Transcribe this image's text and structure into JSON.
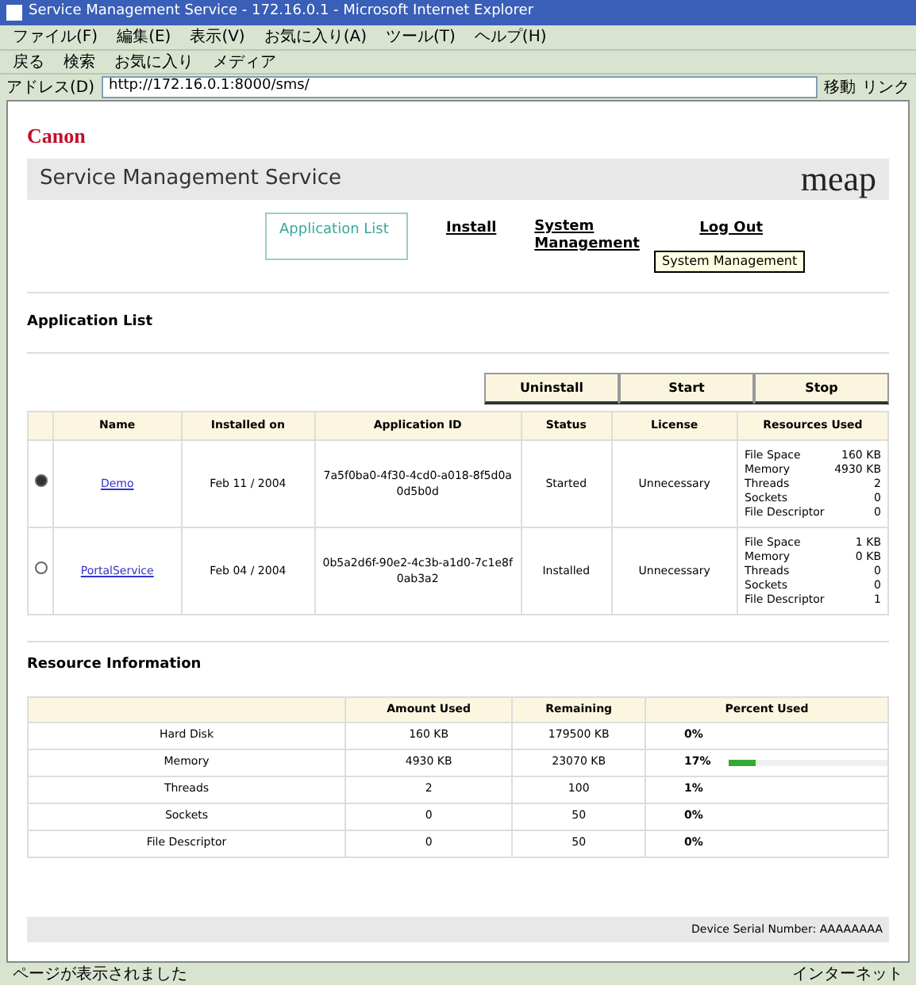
{
  "window": {
    "title": "Service Management Service - 172.16.0.1 - Microsoft Internet Explorer"
  },
  "menu": [
    "ファイル(F)",
    "編集(E)",
    "表示(V)",
    "お気に入り(A)",
    "ツール(T)",
    "ヘルプ(H)"
  ],
  "toolbar": [
    "戻る",
    "検索",
    "お気に入り",
    "メディア"
  ],
  "address_bar": {
    "label": "アドレス(D)",
    "value": "http://172.16.0.1:8000/sms/",
    "go": "移動",
    "links": "リンク"
  },
  "brand": "Canon",
  "banner": {
    "title": "Service Management Service",
    "logo": "meap"
  },
  "nav": [
    {
      "label": "Application List",
      "selected": true
    },
    {
      "label": "Install",
      "selected": false
    },
    {
      "label": "System Management",
      "selected": false
    },
    {
      "label": "Log Out",
      "selected": false
    }
  ],
  "tooltip": "System Management",
  "application_list": {
    "heading": "Application List",
    "buttons": [
      "Uninstall",
      "Start",
      "Stop"
    ],
    "columns": [
      "Name",
      "Installed on",
      "Application ID",
      "Status",
      "License",
      "Resources Used"
    ],
    "rows": [
      {
        "selected": true,
        "name": "Demo",
        "installed_on": "Feb 11 / 2004",
        "application_id": "7a5f0ba0-4f30-4cd0-a018-8f5d0a0d5b0d",
        "status": "Started",
        "license": "Unnecessary",
        "resources": [
          [
            "File Space",
            "160 KB"
          ],
          [
            "Memory",
            "4930 KB"
          ],
          [
            "Threads",
            "2"
          ],
          [
            "Sockets",
            "0"
          ],
          [
            "File Descriptor",
            "0"
          ]
        ]
      },
      {
        "selected": false,
        "name": "PortalService",
        "installed_on": "Feb 04 / 2004",
        "application_id": "0b5a2d6f-90e2-4c3b-a1d0-7c1e8f0ab3a2",
        "status": "Installed",
        "license": "Unnecessary",
        "resources": [
          [
            "File Space",
            "1 KB"
          ],
          [
            "Memory",
            "0 KB"
          ],
          [
            "Threads",
            "0"
          ],
          [
            "Sockets",
            "0"
          ],
          [
            "File Descriptor",
            "1"
          ]
        ]
      }
    ]
  },
  "resource_information": {
    "heading": "Resource Information",
    "columns": [
      "Amount Used",
      "Remaining",
      "Percent Used"
    ],
    "rows": [
      {
        "name": "Hard Disk",
        "used": "160 KB",
        "remaining": "179500 KB",
        "percent": "0%"
      },
      {
        "name": "Memory",
        "used": "4930 KB",
        "remaining": "23070 KB",
        "percent": "17%",
        "level": 0.17
      },
      {
        "name": "Threads",
        "used": "2",
        "remaining": "100",
        "percent": "1%"
      },
      {
        "name": "Sockets",
        "used": "0",
        "remaining": "50",
        "percent": "0%"
      },
      {
        "name": "File Descriptor",
        "used": "0",
        "remaining": "50",
        "percent": "0%"
      }
    ]
  },
  "footer": "Device Serial Number: AAAAAAAA",
  "status_bar": {
    "message": "ページが表示されました",
    "zone": "インターネット"
  }
}
